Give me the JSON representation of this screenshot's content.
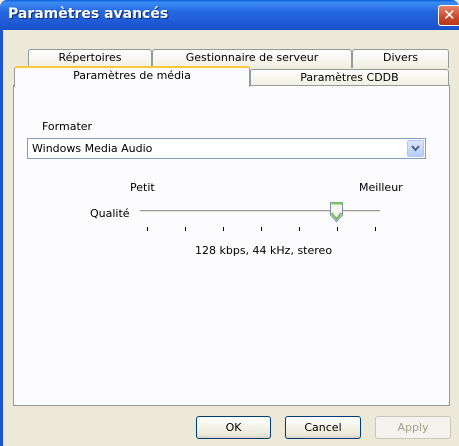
{
  "window": {
    "title": "Paramètres avancés"
  },
  "tabs": {
    "row1": [
      "Répertoires",
      "Gestionnaire de serveur",
      "Divers"
    ],
    "row2": [
      "Paramètres de média",
      "Paramètres CDDB"
    ],
    "active": "Paramètres de média"
  },
  "media": {
    "format_label": "Formater",
    "format_value": "Windows Media Audio",
    "quality_label": "Qualité",
    "min_label": "Petit",
    "max_label": "Meilleur",
    "quality_level_fraction": 0.83,
    "quality_info": "128 kbps, 44 kHz, stereo"
  },
  "buttons": {
    "ok": "OK",
    "cancel": "Cancel",
    "apply": "Apply"
  },
  "icons": {
    "close": "close-icon",
    "dropdown": "chevron-down-icon"
  }
}
